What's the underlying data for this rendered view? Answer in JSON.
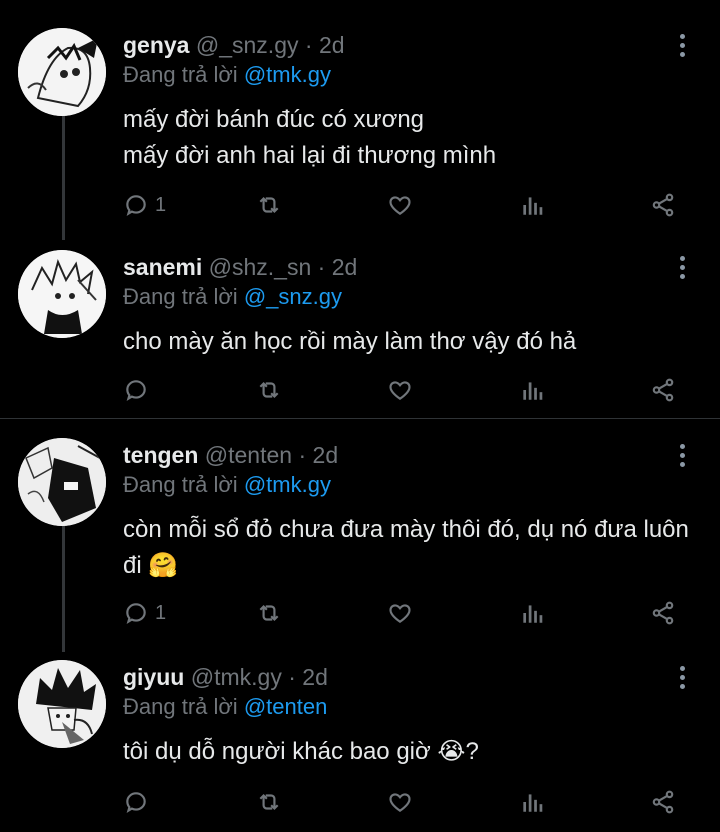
{
  "tweets": [
    {
      "name": "genya",
      "handle": "@_snz.gy",
      "dot": "·",
      "time": "2d",
      "replying_prefix": "Đang trả lời",
      "replying_to": "@tmk.gy",
      "lines": [
        "mấy đời bánh đúc có xương",
        "mấy đời anh hai lại đi thương mình"
      ],
      "reply_count": "1"
    },
    {
      "name": "sanemi",
      "handle": "@shz._sn",
      "dot": "·",
      "time": "2d",
      "replying_prefix": "Đang trả lời",
      "replying_to": "@_snz.gy",
      "lines": [
        "cho mày ăn học rồi mày làm thơ vậy đó hả"
      ],
      "reply_count": ""
    },
    {
      "name": "tengen",
      "handle": "@tenten",
      "dot": "·",
      "time": "2d",
      "replying_prefix": "Đang trả lời",
      "replying_to": "@tmk.gy",
      "lines": [
        "còn mỗi sổ đỏ chưa đưa mày thôi đó, dụ nó đưa luôn",
        "đi"
      ],
      "emoji": "🤗",
      "reply_count": "1"
    },
    {
      "name": "giyuu",
      "handle": "@tmk.gy",
      "dot": "·",
      "time": "2d",
      "replying_prefix": "Đang trả lời",
      "replying_to": "@tenten",
      "lines": [
        "tôi dụ dỗ người khác bao giờ "
      ],
      "emoji": "😭",
      "trailing": "?",
      "reply_count": ""
    }
  ],
  "icons": {
    "reply": "reply-icon",
    "retweet": "retweet-icon",
    "like": "heart-icon",
    "views": "views-icon",
    "share": "share-icon",
    "more": "more-vertical-icon"
  },
  "colors": {
    "background": "#000000",
    "text": "#e7e9ea",
    "muted": "#71767b",
    "link": "#1d9bf0",
    "divider": "#2f3336"
  }
}
